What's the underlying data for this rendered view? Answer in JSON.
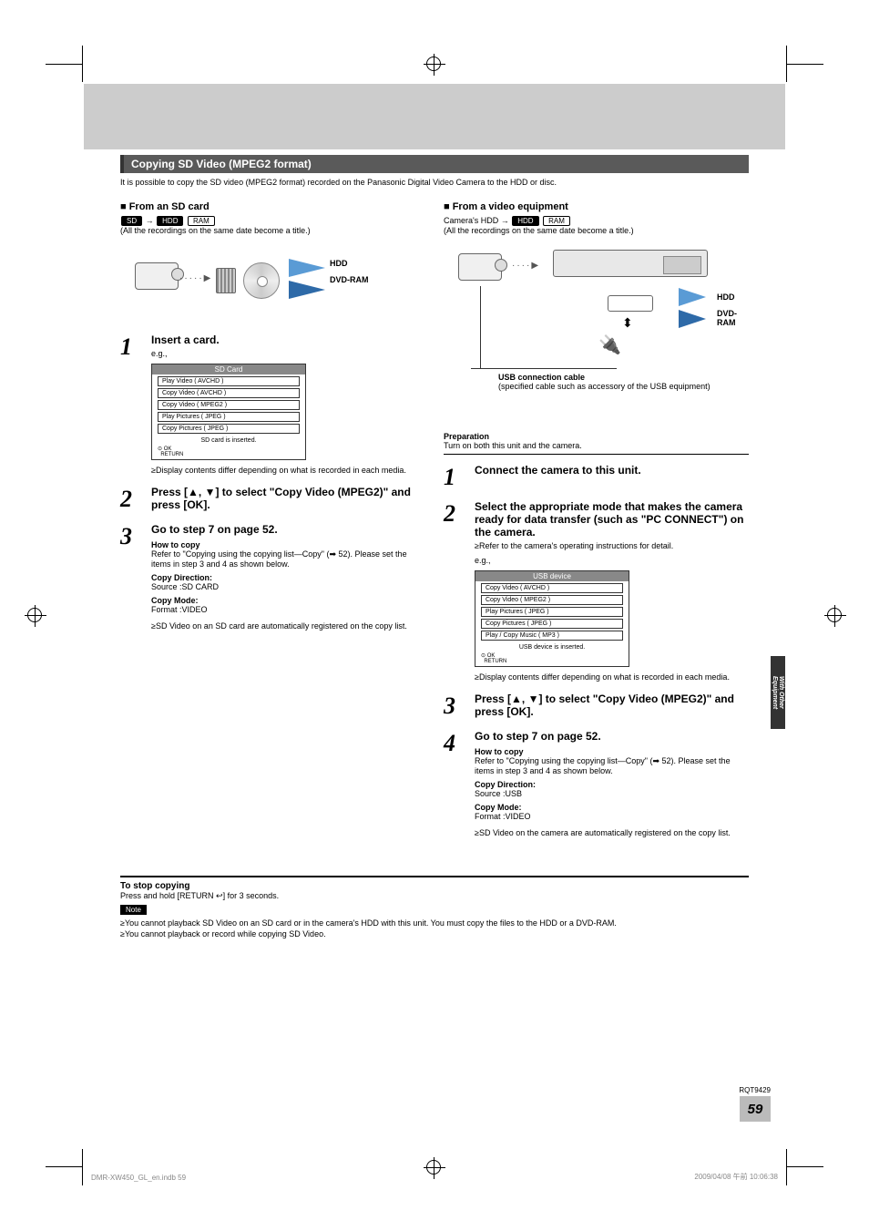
{
  "section_header": "Copying SD Video (MPEG2 format)",
  "intro": "It is possible to copy the SD video (MPEG2 format) recorded on the Panasonic Digital Video Camera to the HDD or disc.",
  "left": {
    "heading": "From an SD card",
    "badge_sd": "SD",
    "badge_hdd": "HDD",
    "badge_ram": "RAM",
    "same_date": "(All the recordings on the same date become a title.)",
    "diag_hdd": "HDD",
    "diag_ram": "DVD-RAM",
    "steps": [
      {
        "num": "1",
        "title": "Insert a card.",
        "eg": "e.g.,",
        "menu_title": "SD Card",
        "menu_items": [
          "Play Video ( AVCHD )",
          "Copy Video ( AVCHD )",
          "Copy Video ( MPEG2 )",
          "Play Pictures ( JPEG )",
          "Copy Pictures ( JPEG )"
        ],
        "menu_footer": "SD card is inserted.",
        "menu_ok": "OK",
        "menu_return": "RETURN",
        "bullet1": "≥Display contents differ depending on what is recorded in each media."
      },
      {
        "num": "2",
        "title": "Press [▲, ▼] to select \"Copy Video (MPEG2)\" and press [OK]."
      },
      {
        "num": "3",
        "title": "Go to step 7 on page 52.",
        "how_title": "How to copy",
        "how_text": "Refer to \"Copying using the copying list—Copy\" (➡ 52). Please set the items in step 3 and 4 as shown below.",
        "cd_label": "Copy Direction:",
        "cd_val": "Source :SD CARD",
        "cm_label": "Copy Mode:",
        "cm_val": "Format :VIDEO",
        "bullet1": "≥SD Video on an SD card are automatically registered on the copy list."
      }
    ]
  },
  "right": {
    "heading": "From a video equipment",
    "cam_hdd": "Camera's HDD →",
    "badge_hdd": "HDD",
    "badge_ram": "RAM",
    "same_date": "(All the recordings on the same date become a title.)",
    "diag_hdd": "HDD",
    "diag_ram": "DVD-RAM",
    "usb_cable": "USB connection cable",
    "usb_spec": "(specified cable such as accessory of the USB equipment)",
    "prep_label": "Preparation",
    "prep_text": "Turn on both this unit and the camera.",
    "steps": [
      {
        "num": "1",
        "title": "Connect the camera to this unit."
      },
      {
        "num": "2",
        "title": "Select the appropriate mode that makes the camera ready for data transfer (such as \"PC CONNECT\") on the camera.",
        "bullet1": "≥Refer to the camera's operating instructions for detail.",
        "eg": "e.g.,",
        "menu_title": "USB device",
        "menu_items": [
          "Copy Video ( AVCHD )",
          "Copy Video ( MPEG2 )",
          "Play Pictures ( JPEG )",
          "Copy Pictures ( JPEG )",
          "Play / Copy Music ( MP3 )"
        ],
        "menu_footer": "USB device is inserted.",
        "menu_ok": "OK",
        "menu_return": "RETURN",
        "bullet2": "≥Display contents differ depending on what is recorded in each media."
      },
      {
        "num": "3",
        "title": "Press [▲, ▼] to select \"Copy Video (MPEG2)\" and press [OK]."
      },
      {
        "num": "4",
        "title": "Go to step 7 on page 52.",
        "how_title": "How to copy",
        "how_text": "Refer to \"Copying using the copying list—Copy\" (➡ 52). Please set the items in step 3 and 4 as shown below.",
        "cd_label": "Copy Direction:",
        "cd_val": "Source :USB",
        "cm_label": "Copy Mode:",
        "cm_val": "Format :VIDEO",
        "bullet1": "≥SD Video on the camera are automatically registered on the copy list."
      }
    ]
  },
  "stop": {
    "title": "To stop copying",
    "text": "Press and hold [RETURN ↩] for 3 seconds."
  },
  "note_label": "Note",
  "notes": [
    "≥You cannot playback SD Video on an SD card or in the camera's HDD with this unit. You must copy the files to the HDD or a DVD-RAM.",
    "≥You cannot playback or record while copying SD Video."
  ],
  "side_tab": "With Other Equipment",
  "rqt": "RQT9429",
  "page_num": "59",
  "footer_left": "DMR-XW450_GL_en.indb   59",
  "footer_right": "2009/04/08   午前 10:06:38"
}
